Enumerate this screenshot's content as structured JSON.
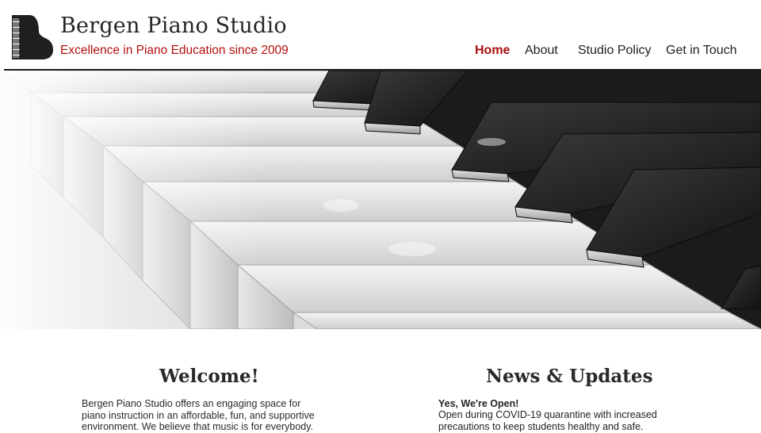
{
  "site": {
    "title": "Bergen Piano Studio",
    "tagline": "Excellence in Piano Education since 2009"
  },
  "nav": {
    "items": [
      {
        "label": "Home",
        "active": true
      },
      {
        "label": "About",
        "active": false
      },
      {
        "label": "Studio Policy",
        "active": false
      },
      {
        "label": "Get in Touch",
        "active": false
      }
    ]
  },
  "hero": {
    "image": "piano-keys-photo"
  },
  "welcome": {
    "heading": "Welcome!",
    "body": "Bergen Piano Studio offers an engaging space for piano instruction in an affordable, fun, and supportive environment. We believe that music is for everybody."
  },
  "news": {
    "heading": "News & Updates",
    "item_title": "Yes, We're Open!",
    "item_body": "Open during COVID-19 quarantine with increased precautions to keep students healthy and safe."
  },
  "colors": {
    "accent": "#b30f0f",
    "text": "#222222",
    "rule": "#1a1a1a"
  }
}
